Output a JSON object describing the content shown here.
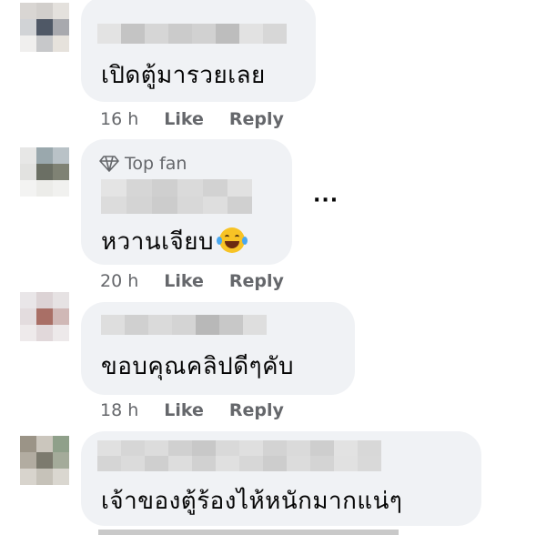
{
  "comments": [
    {
      "text": "เปิดตู้มารวยเลย",
      "time": "16 h",
      "like": "Like",
      "reply": "Reply",
      "top_fan": null,
      "has_emoji": false
    },
    {
      "text": "หวานเจียบ",
      "time": "20 h",
      "like": "Like",
      "reply": "Reply",
      "top_fan": "Top fan",
      "has_emoji": true
    },
    {
      "text": "ขอบคุณคลิปดีๆคับ",
      "time": "18 h",
      "like": "Like",
      "reply": "Reply",
      "top_fan": null,
      "has_emoji": false
    },
    {
      "text": "เจ้าของตู้ร้องไห้หนักมากแน่ๆ",
      "time": null,
      "like": null,
      "reply": null,
      "top_fan": null,
      "has_emoji": false
    }
  ],
  "more_options": "···",
  "colors": {
    "bubble": "#f0f2f5",
    "meta": "#65676b",
    "text": "#050505"
  }
}
